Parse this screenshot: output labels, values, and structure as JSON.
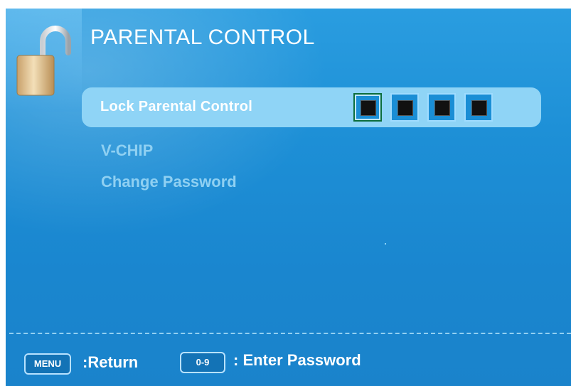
{
  "header": {
    "title": "PARENTAL CONTROL",
    "icon": "unlocked-padlock-icon"
  },
  "menu": {
    "items": [
      {
        "label": "Lock Parental Control",
        "selected": true
      },
      {
        "label": "V-CHIP",
        "selected": false
      },
      {
        "label": "Change Password",
        "selected": false
      }
    ],
    "password": {
      "boxes": 4,
      "filled": 4,
      "active_index": 0
    }
  },
  "footer": {
    "menu_key": "MENU",
    "menu_hint": ":Return",
    "digits_key": "0-9",
    "digits_hint": ": Enter Password"
  },
  "colors": {
    "background": "#1d8fd6",
    "highlight": "#8fd4f6",
    "inactive_text": "#8fd0f2",
    "text": "#ffffff"
  }
}
